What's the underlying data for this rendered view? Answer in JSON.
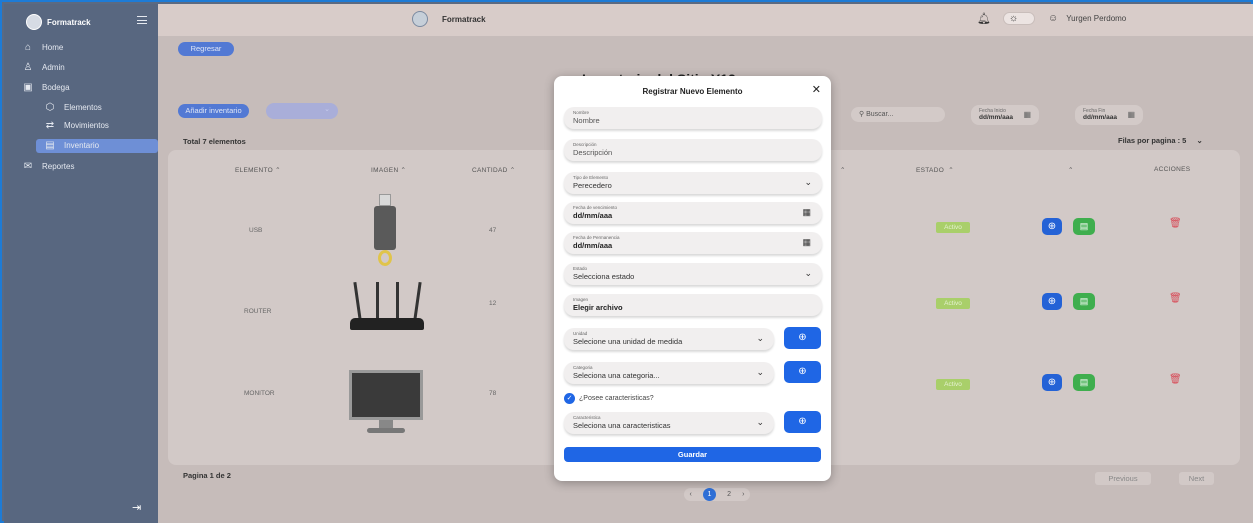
{
  "app": {
    "brand": "Formatrack",
    "header_title": "Formatrack",
    "user_name": "Yurgen Perdomo"
  },
  "sidebar": {
    "items": [
      {
        "label": "Home",
        "icon": "home-icon"
      },
      {
        "label": "Admin",
        "icon": "user-icon"
      },
      {
        "label": "Bodega",
        "icon": "warehouse-icon"
      },
      {
        "label": "Elementos",
        "icon": "cube-icon"
      },
      {
        "label": "Movimientos",
        "icon": "transfer-icon"
      },
      {
        "label": "Inventario",
        "icon": "inventory-icon",
        "active": true
      },
      {
        "label": "Reportes",
        "icon": "mail-icon"
      }
    ]
  },
  "page": {
    "back_label": "Regresar",
    "title": "Inventario del Sitio Y12",
    "add_label": "Añadir inventario",
    "search_placeholder": "Buscar...",
    "date_start_label": "Fecha Inicio",
    "date_start_value": "dd/mm/aaa",
    "date_end_label": "Fecha Fin",
    "date_end_value": "dd/mm/aaa",
    "total_label": "Total 7 elementos",
    "per_page_label": "Filas por pagina : 5",
    "footer_text": "Pagina 1 de 2",
    "previous_label": "Previous",
    "next_label": "Next",
    "page_current": "1",
    "page_other": "2"
  },
  "table": {
    "headers": [
      "ELEMENTO",
      "IMAGEN",
      "CANTIDAD",
      "ESTADO",
      "ACCIONES"
    ],
    "rows": [
      {
        "elemento": "USB",
        "cantidad": "47",
        "estado": "Activo"
      },
      {
        "elemento": "ROUTER",
        "cantidad": "12",
        "estado": "Activo"
      },
      {
        "elemento": "MONITOR",
        "cantidad": "78",
        "estado": "Activo"
      }
    ]
  },
  "modal": {
    "title": "Registrar Nuevo Elemento",
    "nombre_label": "Nombre",
    "nombre_placeholder": "Nombre",
    "descripcion_label": "Descripción",
    "descripcion_placeholder": "Descripción",
    "tipo_label": "Tipo de Elemento",
    "tipo_value": "Perecedero",
    "venc_label": "Fecha de vencimiento",
    "venc_value": "dd/mm/aaa",
    "perm_label": "Fecha de Permanencia",
    "perm_value": "dd/mm/aaa",
    "estado_label": "Estado",
    "estado_value": "Selecciona estado",
    "imagen_label": "Imagen",
    "imagen_value": "Elegir archivo",
    "unidad_label": "Unidad",
    "unidad_value": "Selecione una unidad de medida",
    "categoria_label": "Categoria",
    "categoria_value": "Seleciona una categoria...",
    "posee_label": "¿Posee caracteristicas?",
    "caract_label": "Caracteristica",
    "caract_value": "Seleciona una caracteristicas",
    "save_label": "Guardar"
  },
  "colors": {
    "primary": "#1f66e5",
    "success": "#3fae4e",
    "danger": "#d84a57",
    "sidebar": "#586780"
  }
}
